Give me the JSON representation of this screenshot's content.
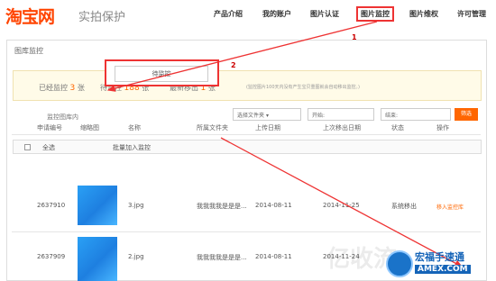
{
  "header": {
    "logo": "淘宝网",
    "logo_sub": "实拍保护",
    "nav": [
      {
        "label": "产品介绍"
      },
      {
        "label": "我的账户"
      },
      {
        "label": "图片认证"
      },
      {
        "label": "图片监控"
      },
      {
        "label": "图片维权"
      },
      {
        "label": "许可管理"
      }
    ]
  },
  "panel": {
    "title": "图库监控",
    "stats": {
      "monitored_label": "已经监控",
      "monitored_value": "3",
      "pending_label": "待监控",
      "pending_value": "188",
      "removed_label": "最新移出",
      "removed_value": "1",
      "unit": "张",
      "note": "(监控图片100天内没有产生宝贝重图就会自动移出监控。)"
    },
    "filter": {
      "in_monitor_label": "监控图库内",
      "pending_tab": "待监控",
      "folder_select": "选择文件夹",
      "start_placeholder": "开始:",
      "end_placeholder": "结束:",
      "filter_button": "筛选"
    },
    "toolbar": {
      "select_all": "全选",
      "batch_add": "批量加入监控"
    },
    "table": {
      "headers": [
        "申请编号",
        "缩略图",
        "名称",
        "所属文件夹",
        "上传日期",
        "上次移出日期",
        "状态",
        "操作"
      ],
      "rows": [
        {
          "id": "2637910",
          "name": "3.jpg",
          "folder": "我我我我是是是...",
          "upload": "2014-08-11",
          "last_removed": "2014-11-25",
          "status": "系统移出",
          "action": "移入监控库"
        },
        {
          "id": "2637909",
          "name": "2.jpg",
          "folder": "我我我我是是是...",
          "upload": "2014-08-11",
          "last_removed": "2014-11-24",
          "status": "",
          "action": ""
        }
      ]
    }
  },
  "annotations": {
    "step1": "1",
    "step2": "2",
    "arrow_color": "#e33"
  },
  "watermark": {
    "line1": "宏福手速通",
    "line2": "AMEX.COM",
    "ghost": "亿收流"
  }
}
